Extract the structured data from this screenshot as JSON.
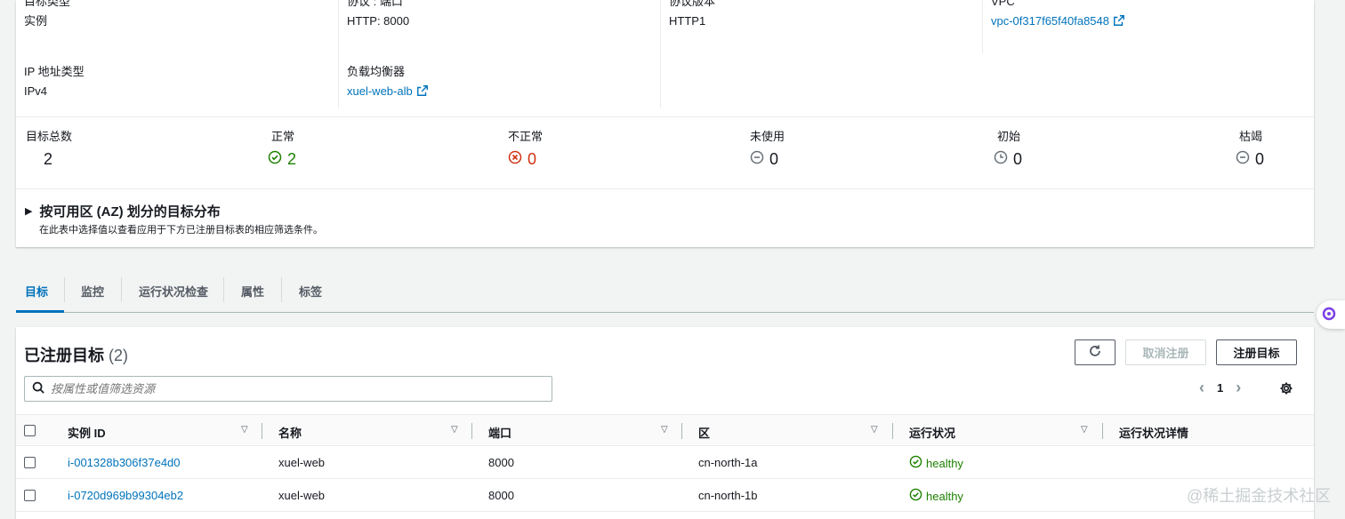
{
  "details": {
    "target_type_label": "目标类型",
    "target_type_value": "实例",
    "protocol_port_label": "协议 : 端口",
    "protocol_port_value": "HTTP: 8000",
    "protocol_version_label": "协议版本",
    "protocol_version_value": "HTTP1",
    "vpc_label": "VPC",
    "vpc_value": "vpc-0f317f65f40fa8548",
    "ip_type_label": "IP 地址类型",
    "ip_type_value": "IPv4",
    "load_balancer_label": "负载均衡器",
    "load_balancer_value": "xuel-web-alb"
  },
  "stats": {
    "total_label": "目标总数",
    "total_value": "2",
    "healthy_label": "正常",
    "healthy_value": "2",
    "unhealthy_label": "不正常",
    "unhealthy_value": "0",
    "unused_label": "未使用",
    "unused_value": "0",
    "initial_label": "初始",
    "initial_value": "0",
    "draining_label": "枯竭",
    "draining_value": "0"
  },
  "az_section": {
    "title": "按可用区 (AZ) 划分的目标分布",
    "description": "在此表中选择值以查看应用于下方已注册目标表的相应筛选条件。"
  },
  "tabs": [
    "目标",
    "监控",
    "运行状况检查",
    "属性",
    "标签"
  ],
  "table": {
    "title": "已注册目标",
    "count": "(2)",
    "deregister_label": "取消注册",
    "register_label": "注册目标",
    "search_placeholder": "按属性或值筛选资源",
    "page": "1",
    "columns": [
      "实例 ID",
      "名称",
      "端口",
      "区",
      "运行状况",
      "运行状况详情"
    ],
    "rows": [
      {
        "id": "i-001328b306f37e4d0",
        "name": "xuel-web",
        "port": "8000",
        "zone": "cn-north-1a",
        "health": "healthy",
        "details": ""
      },
      {
        "id": "i-0720d969b99304eb2",
        "name": "xuel-web",
        "port": "8000",
        "zone": "cn-north-1b",
        "health": "healthy",
        "details": ""
      }
    ]
  },
  "watermark": "@稀土掘金技术社区",
  "colors": {
    "link": "#0073bb",
    "success": "#1d8102",
    "error": "#d13212",
    "neutral": "#687078"
  }
}
